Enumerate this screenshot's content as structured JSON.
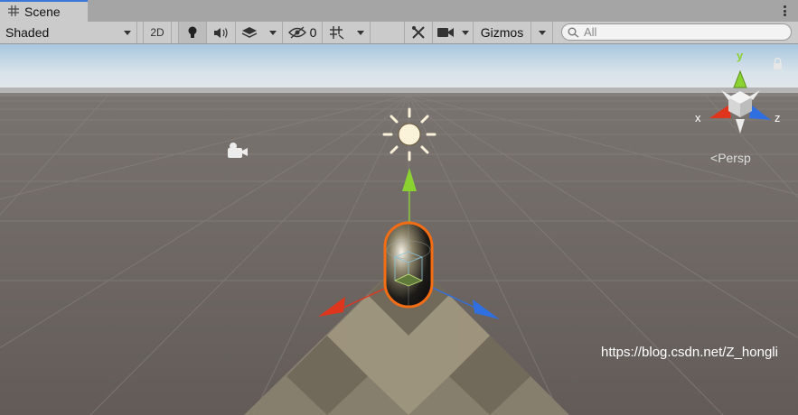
{
  "tab": {
    "title": "Scene"
  },
  "toolbar": {
    "draw_mode": "Shaded",
    "two_d_label": "2D",
    "hidden_count": "0",
    "gizmos_label": "Gizmos"
  },
  "search": {
    "placeholder": "All"
  },
  "scene": {
    "projection_label": "Persp",
    "axis_labels": {
      "x": "x",
      "y": "y",
      "z": "z"
    }
  },
  "watermark": "https://blog.csdn.net/Z_hongli",
  "colors": {
    "x_axis": "#e0351d",
    "y_axis": "#8ad230",
    "z_axis": "#2f6fe0",
    "selection": "#f26d14",
    "tab_accent": "#3a79d7"
  }
}
